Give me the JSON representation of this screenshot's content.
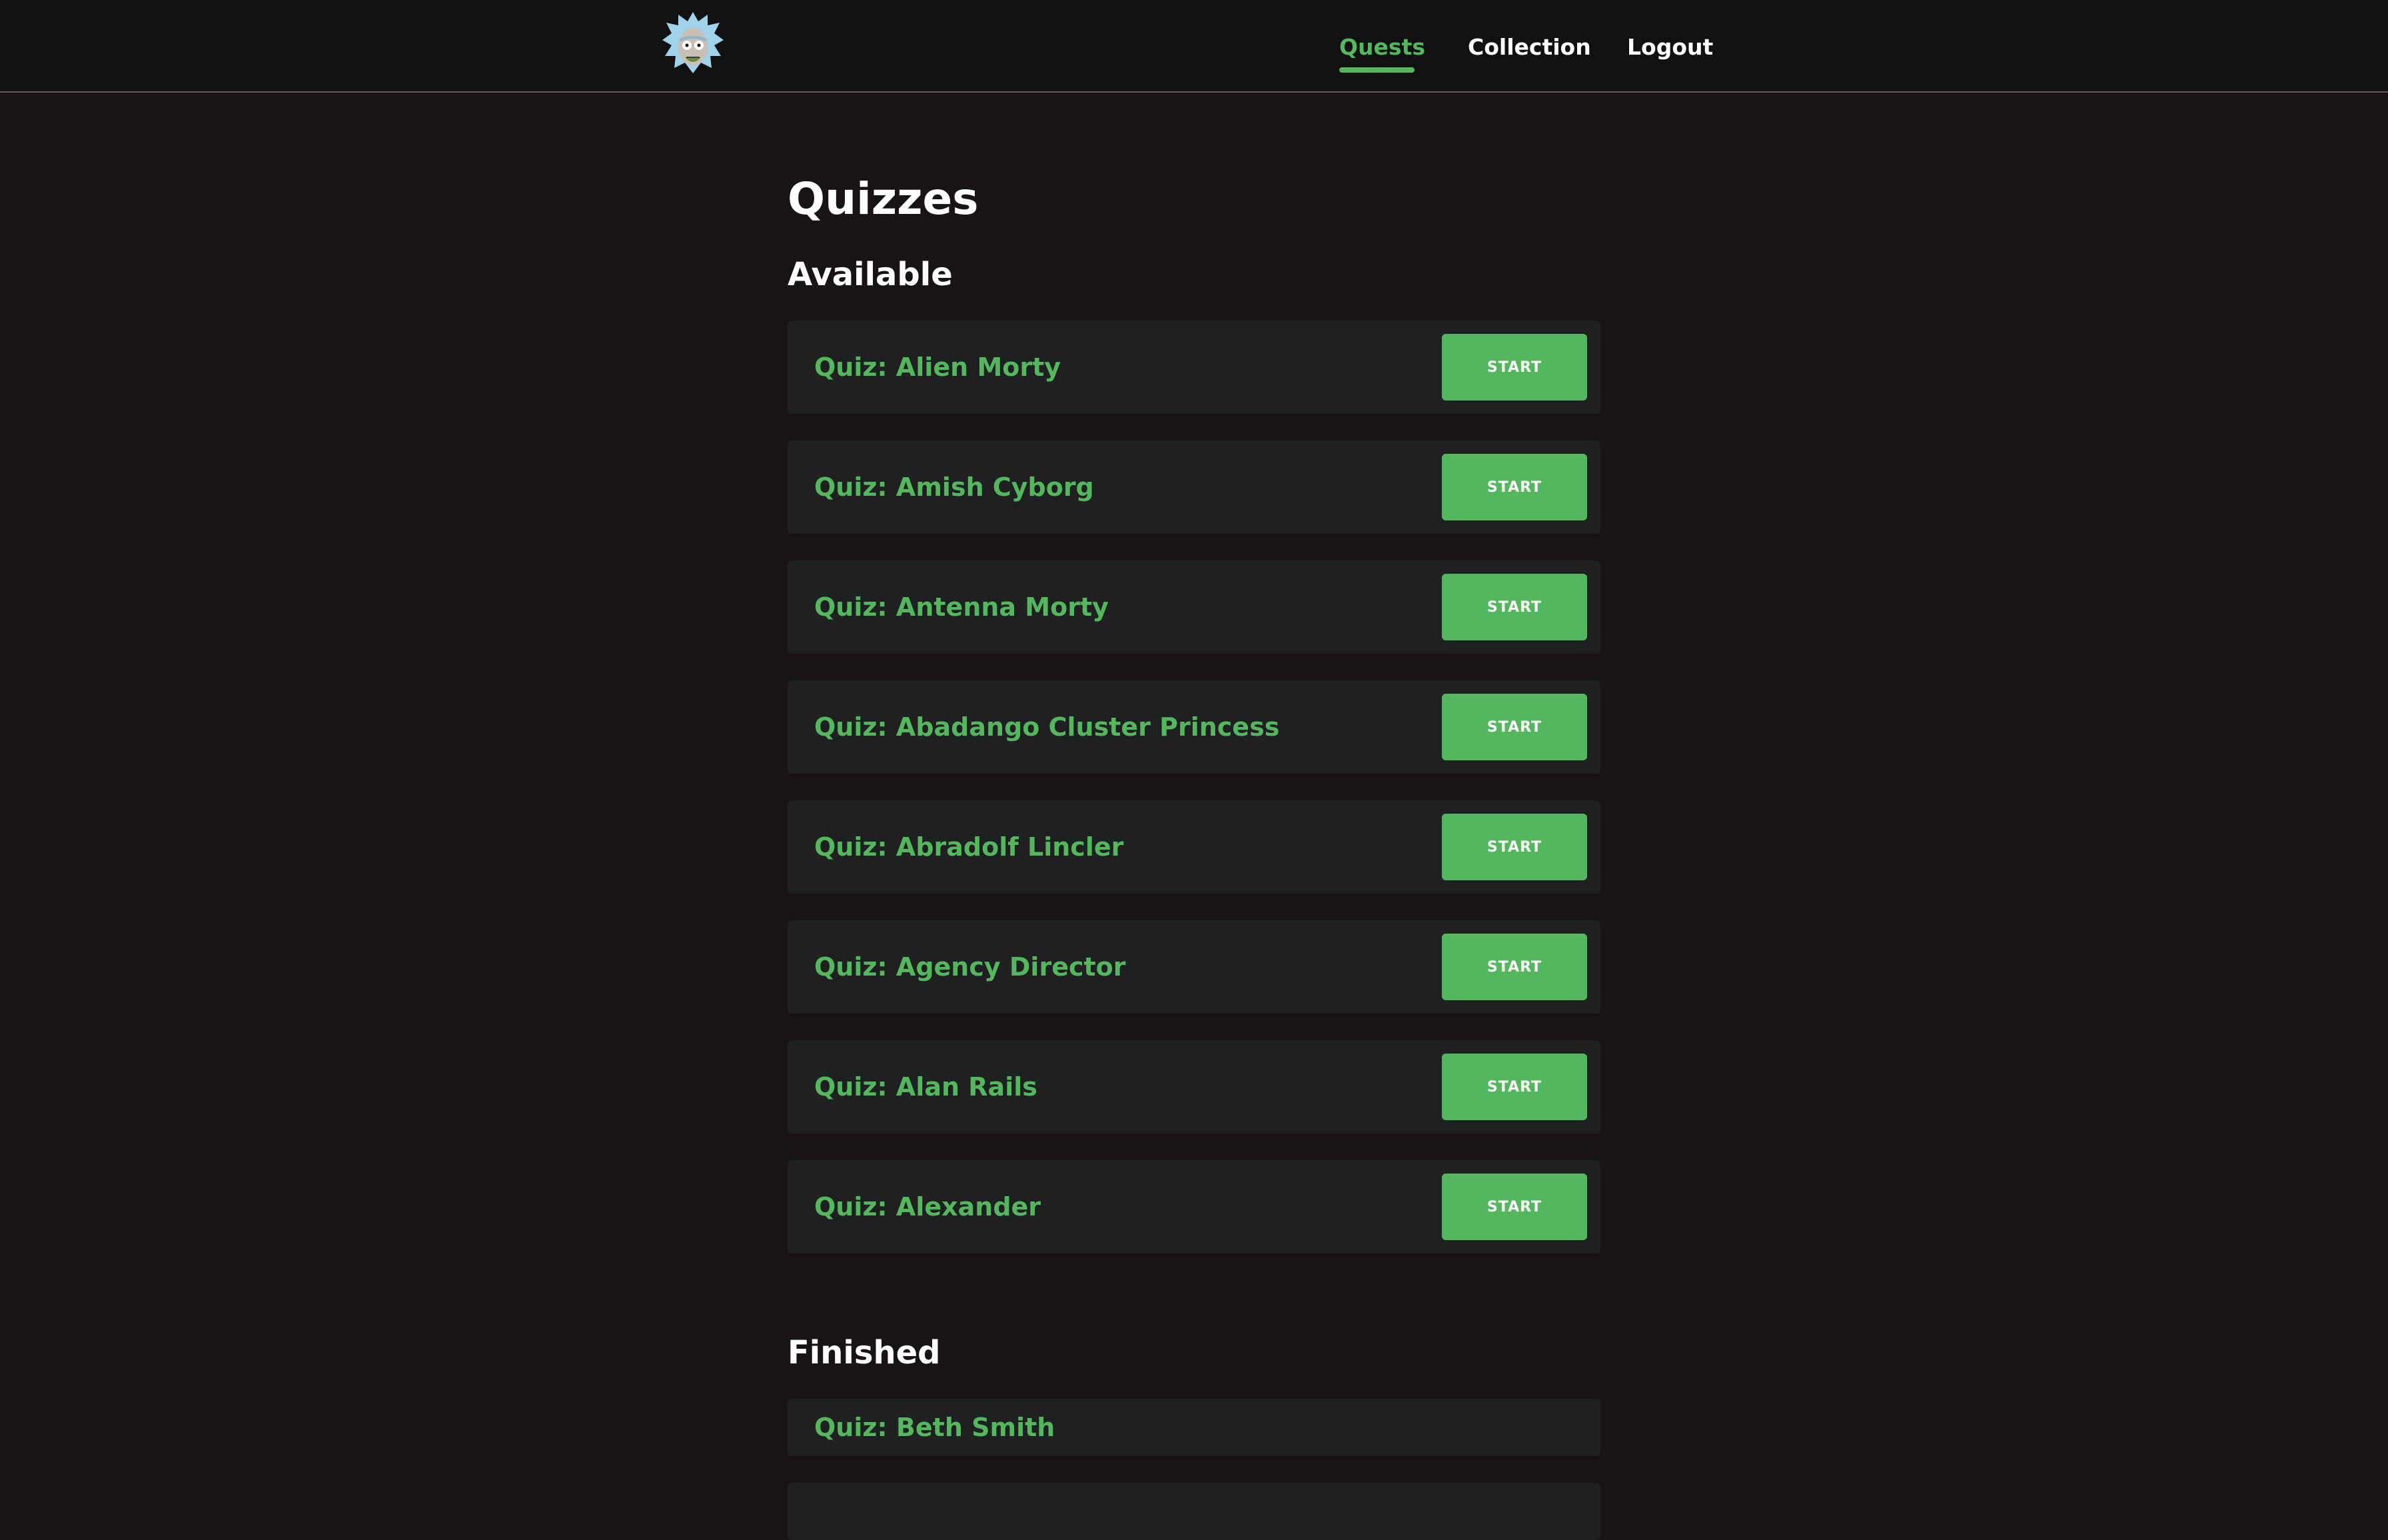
{
  "header": {
    "logo_icon": "rick-avatar-icon",
    "nav": [
      {
        "label": "Quests",
        "active": true
      },
      {
        "label": "Collection",
        "active": false
      },
      {
        "label": "Logout",
        "active": false
      }
    ]
  },
  "main": {
    "title": "Quizzes",
    "available": {
      "title": "Available",
      "button_label": "START",
      "items": [
        {
          "name": "Quiz: Alien Morty"
        },
        {
          "name": "Quiz: Amish Cyborg"
        },
        {
          "name": "Quiz: Antenna Morty"
        },
        {
          "name": "Quiz: Abadango Cluster Princess"
        },
        {
          "name": "Quiz: Abradolf Lincler"
        },
        {
          "name": "Quiz: Agency Director"
        },
        {
          "name": "Quiz: Alan Rails"
        },
        {
          "name": "Quiz: Alexander"
        }
      ]
    },
    "finished": {
      "title": "Finished",
      "items": [
        {
          "name": "Quiz: Beth Smith"
        },
        {
          "name": ""
        }
      ]
    }
  },
  "colors": {
    "accent": "#55b75d",
    "page_background": "#171413",
    "header_background": "#111111",
    "card_background": "#1f2021"
  }
}
